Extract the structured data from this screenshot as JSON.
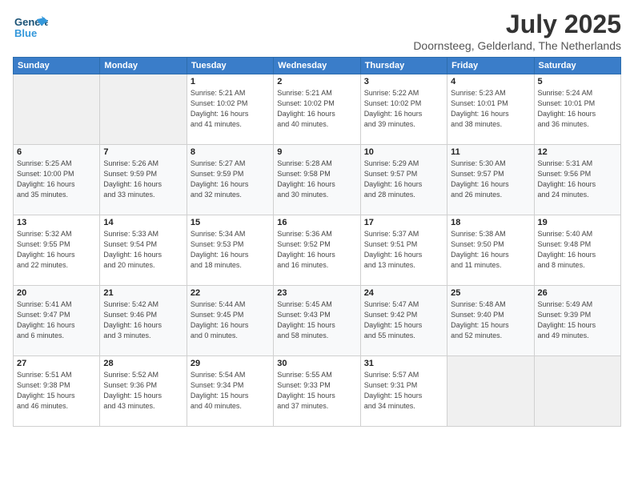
{
  "logo": {
    "line1": "General",
    "line2": "Blue"
  },
  "header": {
    "month_year": "July 2025",
    "location": "Doornsteeg, Gelderland, The Netherlands"
  },
  "weekdays": [
    "Sunday",
    "Monday",
    "Tuesday",
    "Wednesday",
    "Thursday",
    "Friday",
    "Saturday"
  ],
  "weeks": [
    [
      {
        "day": "",
        "info": ""
      },
      {
        "day": "",
        "info": ""
      },
      {
        "day": "1",
        "info": "Sunrise: 5:21 AM\nSunset: 10:02 PM\nDaylight: 16 hours\nand 41 minutes."
      },
      {
        "day": "2",
        "info": "Sunrise: 5:21 AM\nSunset: 10:02 PM\nDaylight: 16 hours\nand 40 minutes."
      },
      {
        "day": "3",
        "info": "Sunrise: 5:22 AM\nSunset: 10:02 PM\nDaylight: 16 hours\nand 39 minutes."
      },
      {
        "day": "4",
        "info": "Sunrise: 5:23 AM\nSunset: 10:01 PM\nDaylight: 16 hours\nand 38 minutes."
      },
      {
        "day": "5",
        "info": "Sunrise: 5:24 AM\nSunset: 10:01 PM\nDaylight: 16 hours\nand 36 minutes."
      }
    ],
    [
      {
        "day": "6",
        "info": "Sunrise: 5:25 AM\nSunset: 10:00 PM\nDaylight: 16 hours\nand 35 minutes."
      },
      {
        "day": "7",
        "info": "Sunrise: 5:26 AM\nSunset: 9:59 PM\nDaylight: 16 hours\nand 33 minutes."
      },
      {
        "day": "8",
        "info": "Sunrise: 5:27 AM\nSunset: 9:59 PM\nDaylight: 16 hours\nand 32 minutes."
      },
      {
        "day": "9",
        "info": "Sunrise: 5:28 AM\nSunset: 9:58 PM\nDaylight: 16 hours\nand 30 minutes."
      },
      {
        "day": "10",
        "info": "Sunrise: 5:29 AM\nSunset: 9:57 PM\nDaylight: 16 hours\nand 28 minutes."
      },
      {
        "day": "11",
        "info": "Sunrise: 5:30 AM\nSunset: 9:57 PM\nDaylight: 16 hours\nand 26 minutes."
      },
      {
        "day": "12",
        "info": "Sunrise: 5:31 AM\nSunset: 9:56 PM\nDaylight: 16 hours\nand 24 minutes."
      }
    ],
    [
      {
        "day": "13",
        "info": "Sunrise: 5:32 AM\nSunset: 9:55 PM\nDaylight: 16 hours\nand 22 minutes."
      },
      {
        "day": "14",
        "info": "Sunrise: 5:33 AM\nSunset: 9:54 PM\nDaylight: 16 hours\nand 20 minutes."
      },
      {
        "day": "15",
        "info": "Sunrise: 5:34 AM\nSunset: 9:53 PM\nDaylight: 16 hours\nand 18 minutes."
      },
      {
        "day": "16",
        "info": "Sunrise: 5:36 AM\nSunset: 9:52 PM\nDaylight: 16 hours\nand 16 minutes."
      },
      {
        "day": "17",
        "info": "Sunrise: 5:37 AM\nSunset: 9:51 PM\nDaylight: 16 hours\nand 13 minutes."
      },
      {
        "day": "18",
        "info": "Sunrise: 5:38 AM\nSunset: 9:50 PM\nDaylight: 16 hours\nand 11 minutes."
      },
      {
        "day": "19",
        "info": "Sunrise: 5:40 AM\nSunset: 9:48 PM\nDaylight: 16 hours\nand 8 minutes."
      }
    ],
    [
      {
        "day": "20",
        "info": "Sunrise: 5:41 AM\nSunset: 9:47 PM\nDaylight: 16 hours\nand 6 minutes."
      },
      {
        "day": "21",
        "info": "Sunrise: 5:42 AM\nSunset: 9:46 PM\nDaylight: 16 hours\nand 3 minutes."
      },
      {
        "day": "22",
        "info": "Sunrise: 5:44 AM\nSunset: 9:45 PM\nDaylight: 16 hours\nand 0 minutes."
      },
      {
        "day": "23",
        "info": "Sunrise: 5:45 AM\nSunset: 9:43 PM\nDaylight: 15 hours\nand 58 minutes."
      },
      {
        "day": "24",
        "info": "Sunrise: 5:47 AM\nSunset: 9:42 PM\nDaylight: 15 hours\nand 55 minutes."
      },
      {
        "day": "25",
        "info": "Sunrise: 5:48 AM\nSunset: 9:40 PM\nDaylight: 15 hours\nand 52 minutes."
      },
      {
        "day": "26",
        "info": "Sunrise: 5:49 AM\nSunset: 9:39 PM\nDaylight: 15 hours\nand 49 minutes."
      }
    ],
    [
      {
        "day": "27",
        "info": "Sunrise: 5:51 AM\nSunset: 9:38 PM\nDaylight: 15 hours\nand 46 minutes."
      },
      {
        "day": "28",
        "info": "Sunrise: 5:52 AM\nSunset: 9:36 PM\nDaylight: 15 hours\nand 43 minutes."
      },
      {
        "day": "29",
        "info": "Sunrise: 5:54 AM\nSunset: 9:34 PM\nDaylight: 15 hours\nand 40 minutes."
      },
      {
        "day": "30",
        "info": "Sunrise: 5:55 AM\nSunset: 9:33 PM\nDaylight: 15 hours\nand 37 minutes."
      },
      {
        "day": "31",
        "info": "Sunrise: 5:57 AM\nSunset: 9:31 PM\nDaylight: 15 hours\nand 34 minutes."
      },
      {
        "day": "",
        "info": ""
      },
      {
        "day": "",
        "info": ""
      }
    ]
  ]
}
